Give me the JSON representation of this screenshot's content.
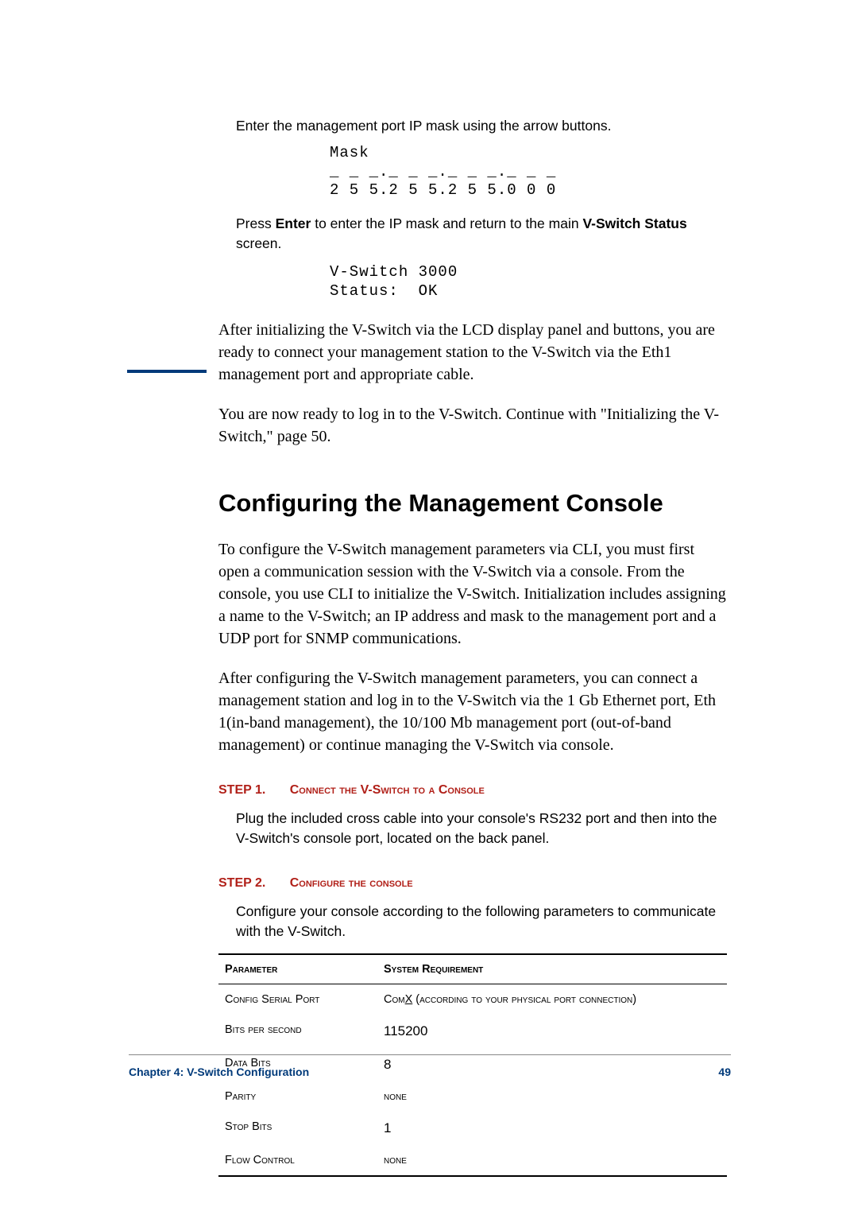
{
  "intro": {
    "p1": "Enter the management port IP mask using the arrow buttons.",
    "mask_block": "Mask\n_ _ _._ _ _._ _ _._ _ _\n2 5 5.2 5 5.2 5 5.0 0 0",
    "p2_a": "Press ",
    "p2_enter": "Enter",
    "p2_b": " to enter the IP mask and return to the main ",
    "p2_vss": "V-Switch Status",
    "p2_c": " screen.",
    "status_block": "V-Switch 3000\nStatus:  OK",
    "para_after1": "After initializing the V-Switch via the LCD display panel and buttons, you are ready to connect your management station to the V-Switch via the Eth1 management port and appropriate cable.",
    "para_after2": "You are now ready to log in to the V-Switch.  Continue with \"Initializing the V-Switch,\" page 50."
  },
  "section": {
    "heading": "Configuring the Management Console",
    "p1": "To configure the V-Switch management parameters via CLI, you must first open a communication session with the V-Switch via a console.  From the console, you use CLI to initialize the V-Switch.  Initialization includes assigning a name to the V-Switch; an IP address and mask to the management port and a UDP port for SNMP communications.",
    "p2": "After configuring the V-Switch management parameters, you can connect a management station and log in to the V-Switch via the 1 Gb Ethernet port, Eth 1(in-band management), the 10/100 Mb management port (out-of-band management) or continue managing the V-Switch via console."
  },
  "steps": {
    "s1_label": "STEP 1.",
    "s1_title": "Connect the V-Switch to a Console",
    "s1_body": "Plug the included cross cable into your console's RS232 port and then into the V-Switch's console port, located on the back panel.",
    "s2_label": "STEP 2.",
    "s2_title": "Configure the console",
    "s2_body": "Configure your console according to the following parameters to communicate with the V-Switch."
  },
  "table": {
    "head_param": "Parameter",
    "head_req": "System Requirement",
    "rows": [
      {
        "param": "Config Serial Port",
        "value_sc_pre": "Com",
        "value_x": "X",
        "value_sc_post": " (according to your physical port connection)",
        "num": false
      },
      {
        "param": "Bits per second",
        "value": "115200",
        "num": true
      },
      {
        "param": "Data Bits",
        "value": "8",
        "num": true
      },
      {
        "param": "Parity",
        "value": "none",
        "sc": true
      },
      {
        "param": "Stop Bits",
        "value": "1",
        "num": true
      },
      {
        "param": "Flow Control",
        "value": "none",
        "sc": true
      }
    ]
  },
  "footer": {
    "left": "Chapter 4:  V-Switch Configuration",
    "right": "49"
  }
}
